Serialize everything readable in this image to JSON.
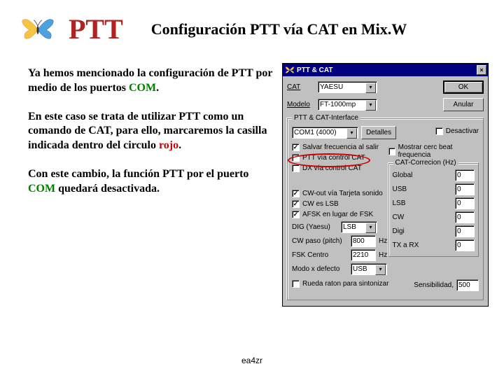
{
  "header": {
    "title_main": "PTT",
    "title_sub": "Configuración PTT vía CAT en Mix.W"
  },
  "text": {
    "p1": "Ya hemos mencionado la configuración de PTT por medio de los puertos ",
    "p1_green": "COM",
    "p1_end": ".",
    "p2": "En este caso se trata de utilizar PTT como un comando de CAT, para ello, marcaremos la casilla indicada dentro del circulo ",
    "p2_red": "rojo",
    "p2_end": ".",
    "p3a": "Con este cambio, la función PTT por el puerto ",
    "p3_green": "COM",
    "p3b": " quedará desactivada."
  },
  "dialog": {
    "title": "PTT & CAT",
    "labels": {
      "cat": "CAT",
      "modelo": "Modelo",
      "grp_if": "PTT & CAT-Interface",
      "detalles": "Detalles",
      "desactivar": "Desactivar",
      "salvar": "Salvar frecuencia al salir",
      "mostrar": "Mostrar cerc beat frequencia",
      "ptt_cat": "PTT vía control CAT",
      "dx_cat": "DX vía control CAT",
      "grp_corr": "CAT-Correcion (Hz)",
      "global": "Global",
      "usb": "USB",
      "lsb_corr": "LSB",
      "cw_corr": "CW",
      "digi_corr": "Digi",
      "txrx": "TX a RX",
      "cw_out": "CW-out vía Tarjeta sonido",
      "cw_lsb": "CW es LSB",
      "afsk": "AFSK en lugar de FSK",
      "dig_yaesu": "DIG (Yaesu)",
      "cw_pitch": "CW paso (pitch)",
      "fsk_centro": "FSK Centro",
      "modo_def": "Modo x defecto",
      "hz": "Hz",
      "rueda": "Rueda raton para sintonizar",
      "sensibilidad": "Sensibilidad,",
      "ok": "OK",
      "anular": "Anular"
    },
    "values": {
      "cat_combo": "YAESU",
      "modelo_combo": "FT-1000mp",
      "port": "COM1 (4000)",
      "dig_combo": "LSB",
      "cw_pitch": "800",
      "fsk_centro": "2210",
      "modo_def": "USB",
      "global": "0",
      "usb": "0",
      "lsb": "0",
      "cw": "0",
      "digi": "0",
      "txrx": "0",
      "sens": "500"
    }
  },
  "footer": "ea4zr"
}
